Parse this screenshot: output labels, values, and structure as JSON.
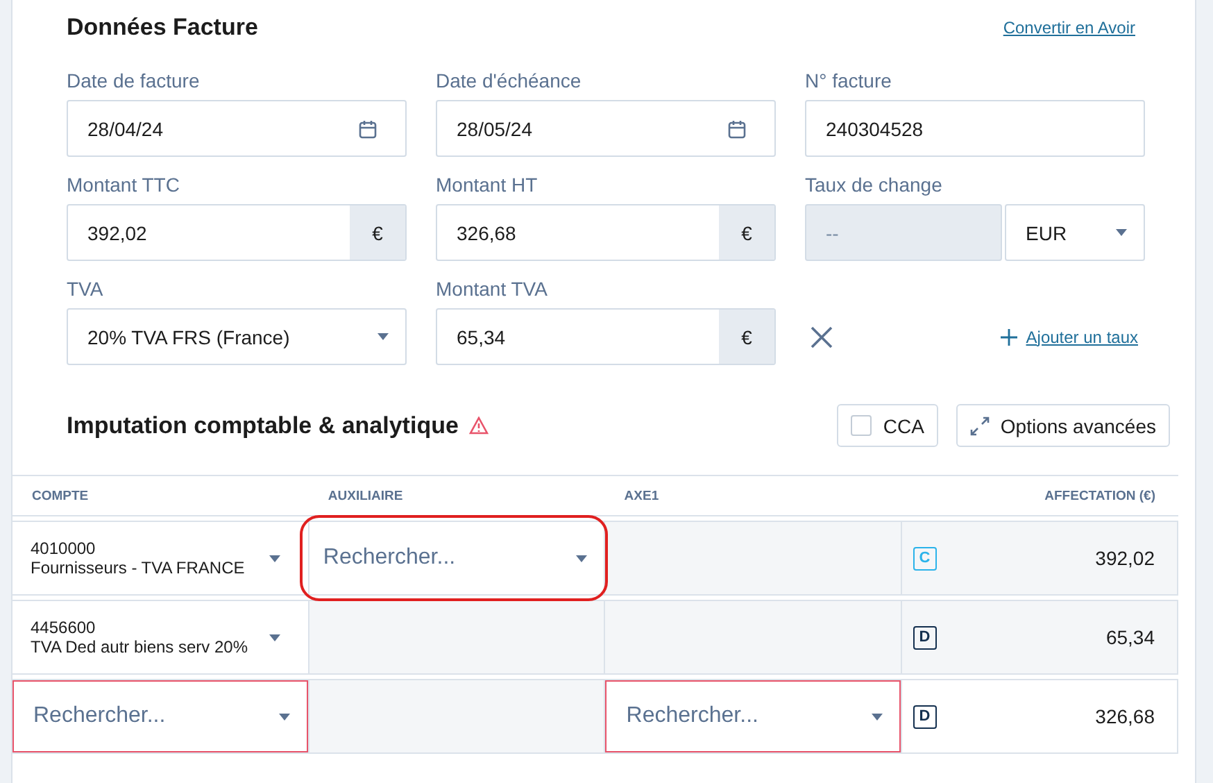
{
  "header": {
    "title": "Données Facture",
    "link": "Convertir en Avoir"
  },
  "fields": [
    {
      "kind": "date",
      "label": "Date de facture",
      "value": "28/04/24"
    },
    {
      "kind": "date",
      "label": "Date d'échéance",
      "value": "28/05/24"
    },
    {
      "kind": "text",
      "label": "N° facture",
      "value": "240304528"
    },
    {
      "kind": "amount",
      "label": "Montant TTC",
      "value": "392,02",
      "unit": "€"
    },
    {
      "kind": "amount",
      "label": "Montant HT",
      "value": "326,68",
      "unit": "€"
    },
    {
      "kind": "rate",
      "label": "Taux de change",
      "value": "--",
      "disabled": true,
      "currency": "EUR"
    },
    {
      "kind": "select",
      "label": "TVA",
      "value": "20% TVA FRS (France)"
    },
    {
      "kind": "amount",
      "label": "Montant TVA",
      "value": "65,34",
      "unit": "€"
    },
    {
      "kind": "actions",
      "link": "Ajouter un taux"
    }
  ],
  "imputation": {
    "title": "Imputation comptable & analytique",
    "warning": true,
    "cca": {
      "label": "CCA",
      "checked": false
    },
    "options": "Options avancées"
  },
  "table": {
    "columns": [
      "COMPTE",
      "AUXILIAIRE",
      "AXE1",
      "AFFECTATION (€)"
    ],
    "rows": [
      {
        "cells": [
          {
            "kind": "account",
            "code": "4010000",
            "name": "Fournisseurs - TVA FRANCE"
          },
          {
            "kind": "search",
            "placeholder": "Rechercher...",
            "invalid": false,
            "highlighted": true
          },
          {
            "kind": "empty"
          }
        ],
        "sens": {
          "label": "C",
          "color": "#2bb3ea"
        },
        "amount": "392,02"
      },
      {
        "cells": [
          {
            "kind": "account",
            "code": "4456600",
            "name": "TVA Ded autr biens serv 20%"
          },
          {
            "kind": "empty"
          },
          {
            "kind": "empty"
          }
        ],
        "sens": {
          "label": "D",
          "color": "#14304f"
        },
        "amount": "65,34"
      },
      {
        "cells": [
          {
            "kind": "search",
            "placeholder": "Rechercher...",
            "invalid": true,
            "highlighted": false
          },
          {
            "kind": "empty"
          },
          {
            "kind": "search",
            "placeholder": "Rechercher...",
            "invalid": true,
            "highlighted": false
          }
        ],
        "sens": {
          "label": "D",
          "color": "#14304f"
        },
        "amount": "326,68"
      }
    ]
  }
}
